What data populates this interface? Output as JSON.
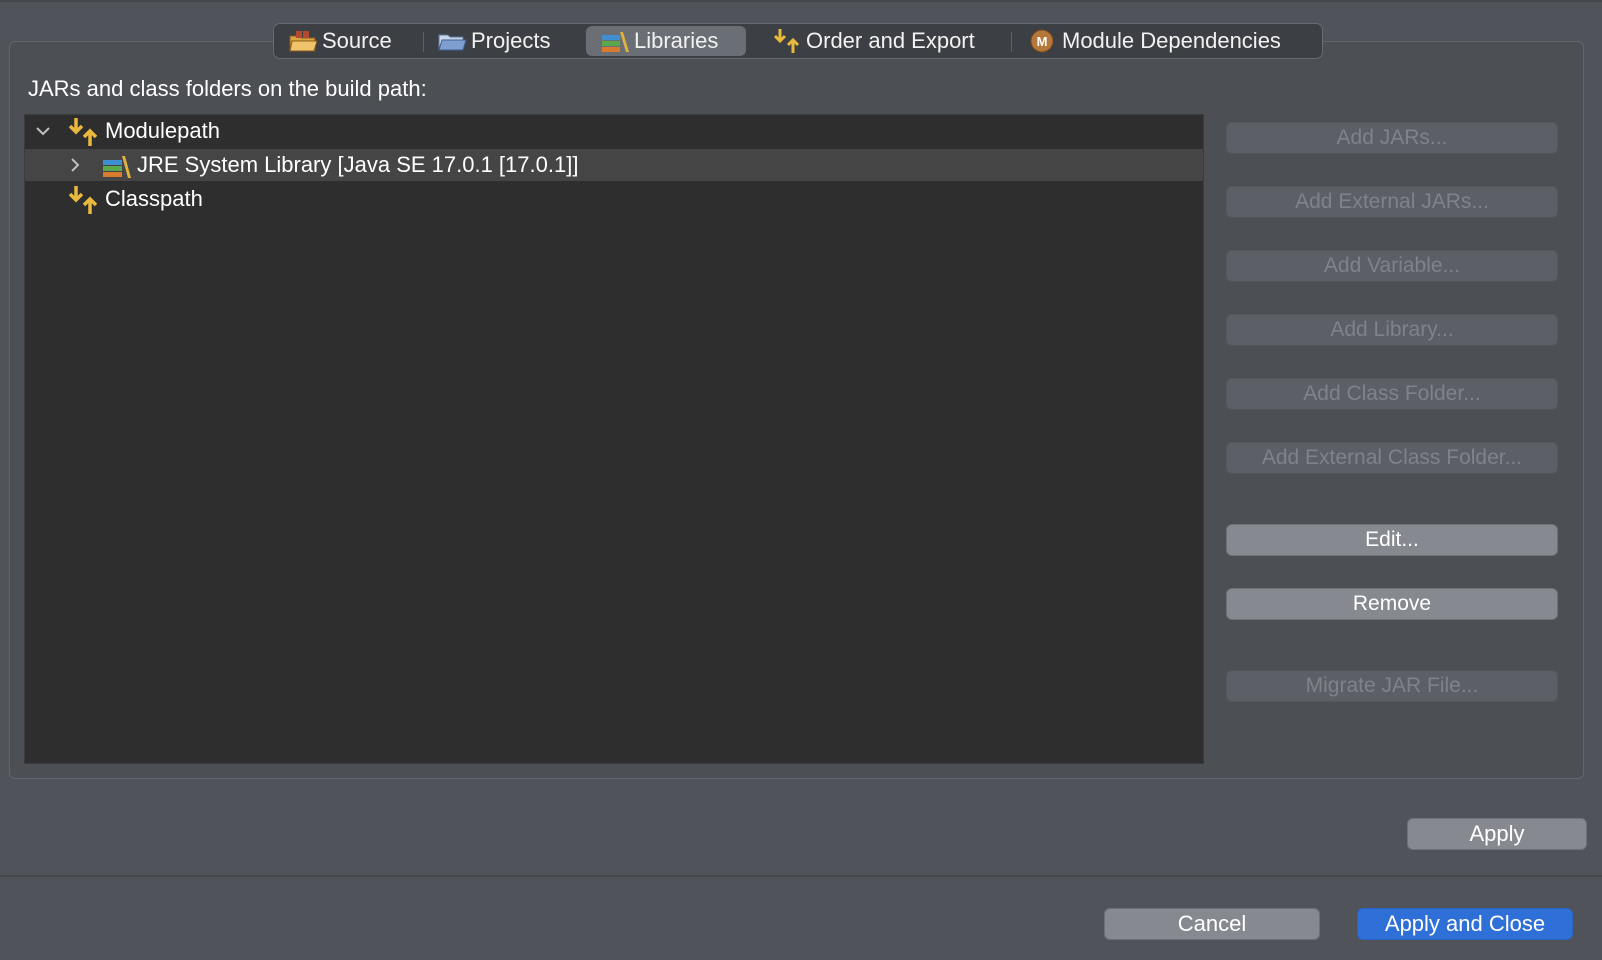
{
  "tabs": [
    {
      "label": "Source",
      "icon": "source-folder-icon",
      "selected": false
    },
    {
      "label": "Projects",
      "icon": "projects-folder-icon",
      "selected": false
    },
    {
      "label": "Libraries",
      "icon": "libraries-icon",
      "selected": true
    },
    {
      "label": "Order and Export",
      "icon": "order-export-icon",
      "selected": false
    },
    {
      "label": "Module Dependencies",
      "icon": "module-dependencies-icon",
      "selected": false
    }
  ],
  "build_path_label": "JARs and class folders on the build path:",
  "tree": {
    "modulepath": {
      "label": "Modulepath",
      "icon": "modulepath-icon",
      "expanded": true
    },
    "jre_library": {
      "label": "JRE System Library [Java SE 17.0.1 [17.0.1]]",
      "icon": "library-icon",
      "expanded": false,
      "selected": true
    },
    "classpath": {
      "label": "Classpath",
      "icon": "classpath-icon"
    }
  },
  "buttons": {
    "add_jars": "Add JARs...",
    "add_external_jars": "Add External JARs...",
    "add_variable": "Add Variable...",
    "add_library": "Add Library...",
    "add_class_folder": "Add Class Folder...",
    "add_external_class_folder": "Add External Class Folder...",
    "edit": "Edit...",
    "remove": "Remove",
    "migrate_jar": "Migrate JAR File...",
    "apply": "Apply",
    "cancel": "Cancel",
    "apply_and_close": "Apply and Close"
  },
  "colors": {
    "background": "#50545a",
    "tree_background": "#2e2e2e",
    "primary_button": "#2f6fd8",
    "selected_tab": "#6a6e75"
  }
}
